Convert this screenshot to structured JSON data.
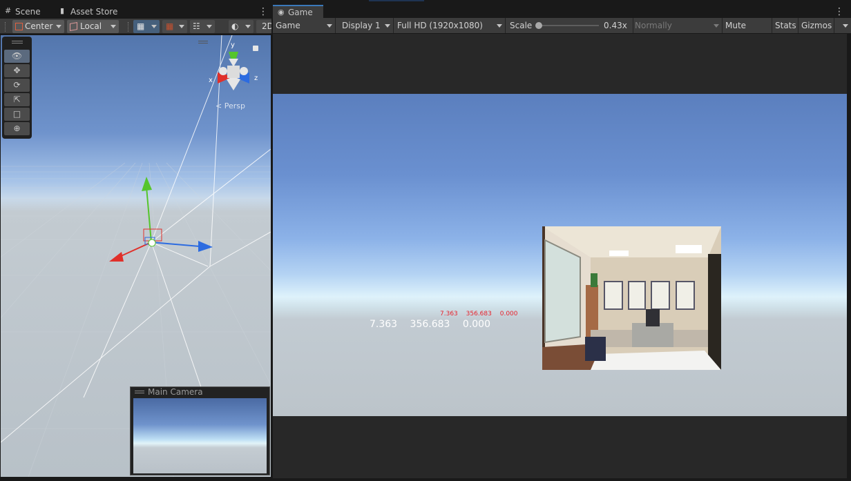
{
  "scene_tabs": {
    "scene_label": "Scene",
    "asset_store_label": "Asset Store"
  },
  "scene_toolbar": {
    "pivot_label": "Center",
    "space_label": "Local",
    "twod_label": "2D"
  },
  "scene_view": {
    "gizmo_axes": {
      "x": "x",
      "y": "y",
      "z": "z"
    },
    "projection_label": "Persp",
    "tools": [
      "view-tool",
      "move-tool",
      "rotate-tool",
      "scale-tool",
      "rect-tool",
      "transform-tool"
    ]
  },
  "camera_preview": {
    "title": "Main Camera"
  },
  "game_tab": {
    "label": "Game"
  },
  "game_toolbar": {
    "view_mode": "Game",
    "display": "Display 1",
    "resolution": "Full HD (1920x1080)",
    "scale_label": "Scale",
    "scale_value": "0.43x",
    "scale_fraction": 0.0,
    "play_focus": "Normally",
    "mute_label": "Mute Audio",
    "stats_label": "Stats",
    "gizmos_label": "Gizmos"
  },
  "game_view": {
    "readout_large": [
      "7.363",
      "356.683",
      "0.000"
    ],
    "readout_small": [
      "7.363",
      "356.683",
      "0.000"
    ],
    "readout_small_color": "#e8202a"
  },
  "colors": {
    "accent": "#3a79bb",
    "axis_x": "#e0302a",
    "axis_y": "#55c52c",
    "axis_z": "#2c6be0"
  }
}
